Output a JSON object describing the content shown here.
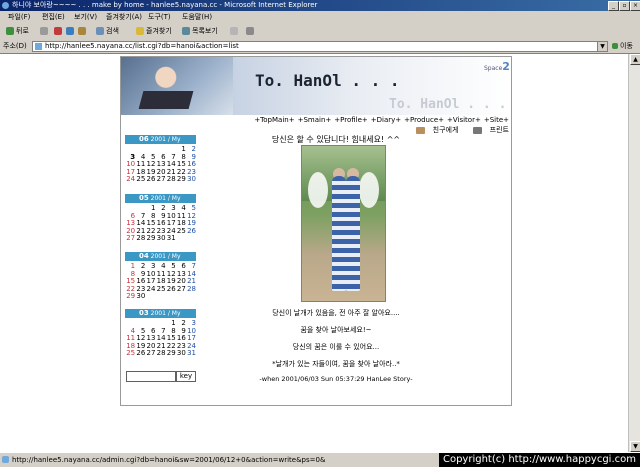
{
  "window": {
    "title": "하니야 보아랑~~~~ . . . make by home - hanlee5.nayana.cc - Microsoft Internet Explorer",
    "buttons": [
      "_",
      "▫",
      "×"
    ]
  },
  "menubar": [
    "파일(F)",
    "편집(E)",
    "보기(V)",
    "즐겨찾기(A)",
    "도구(T)",
    "도움말(H)"
  ],
  "toolbar": {
    "back": "뒤로",
    "search": "검색",
    "favorites": "즐겨찾기",
    "history": "목록보기"
  },
  "address": {
    "label": "주소(D)",
    "url": "http://hanlee5.nayana.cc/list.cgi?db=hanoi&action=list",
    "go": "이동"
  },
  "banner": {
    "title": "To. HanOl . . .",
    "title_reflection": "To. HanOl . . .",
    "space_label": "Space",
    "space_num": "2"
  },
  "nav": [
    "+TopMain+",
    "+Smain+",
    "+Profile+",
    "+Diary+",
    "+Produce+",
    "+Visitor+",
    "+Site+"
  ],
  "tools": {
    "friend": "친구에게",
    "print": "프린트"
  },
  "main": {
    "heading": "당신은 할 수 있답니다! 힘내세요! ^^",
    "lines": [
      "당신이 날개가 있음을, 전 아주 잘 알아요....",
      "꿈을 찾아 날아보세요!~",
      "당신의 꿈은 이룰 수 있어요...",
      "*날개가 있는 자들이여, 꿈을 찾아 날아라..*"
    ],
    "footer": "-when 2001/06/03 Sun 05:37:29  HanLee Story-"
  },
  "calendars": [
    {
      "month": "06",
      "year": "2001",
      "tag": "My",
      "offset": 5,
      "days": 30,
      "today": 3
    },
    {
      "month": "05",
      "year": "2001",
      "tag": "My",
      "offset": 2,
      "days": 31,
      "today": 0
    },
    {
      "month": "04",
      "year": "2001",
      "tag": "My",
      "offset": 0,
      "days": 30,
      "today": 0
    },
    {
      "month": "03",
      "year": "2001",
      "tag": "My",
      "offset": 4,
      "days": 31,
      "today": 0
    }
  ],
  "keyform": {
    "button": "key"
  },
  "status": {
    "text": "http://hanlee5.nayana.cc/admin.cgi?db=hanoi&sw=2001/06/12+0&action=write&ps=0&",
    "copyright": "Copyright(c) http://www.happycgi.com"
  }
}
